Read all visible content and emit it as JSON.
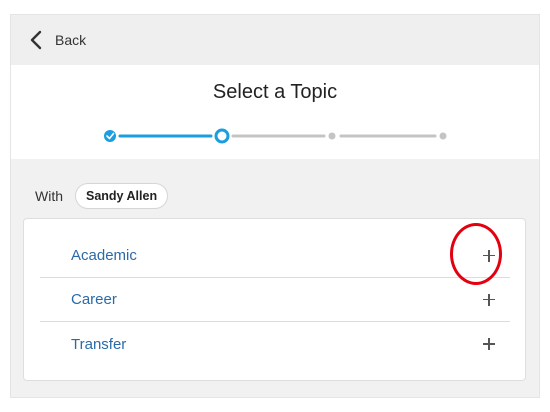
{
  "topbar": {
    "back_label": "Back"
  },
  "header": {
    "title": "Select a Topic"
  },
  "stepper": {
    "current_step": 2,
    "total_steps": 4,
    "active_color": "#1a9ee0",
    "inactive_color": "#c4c4c4"
  },
  "with": {
    "label": "With",
    "person": "Sandy Allen"
  },
  "topics": [
    {
      "label": "Academic",
      "action_icon": "plus-icon"
    },
    {
      "label": "Career",
      "action_icon": "plus-icon"
    },
    {
      "label": "Transfer",
      "action_icon": "plus-icon"
    }
  ],
  "colors": {
    "link": "#2a6aa8",
    "highlight": "#e3000f"
  }
}
